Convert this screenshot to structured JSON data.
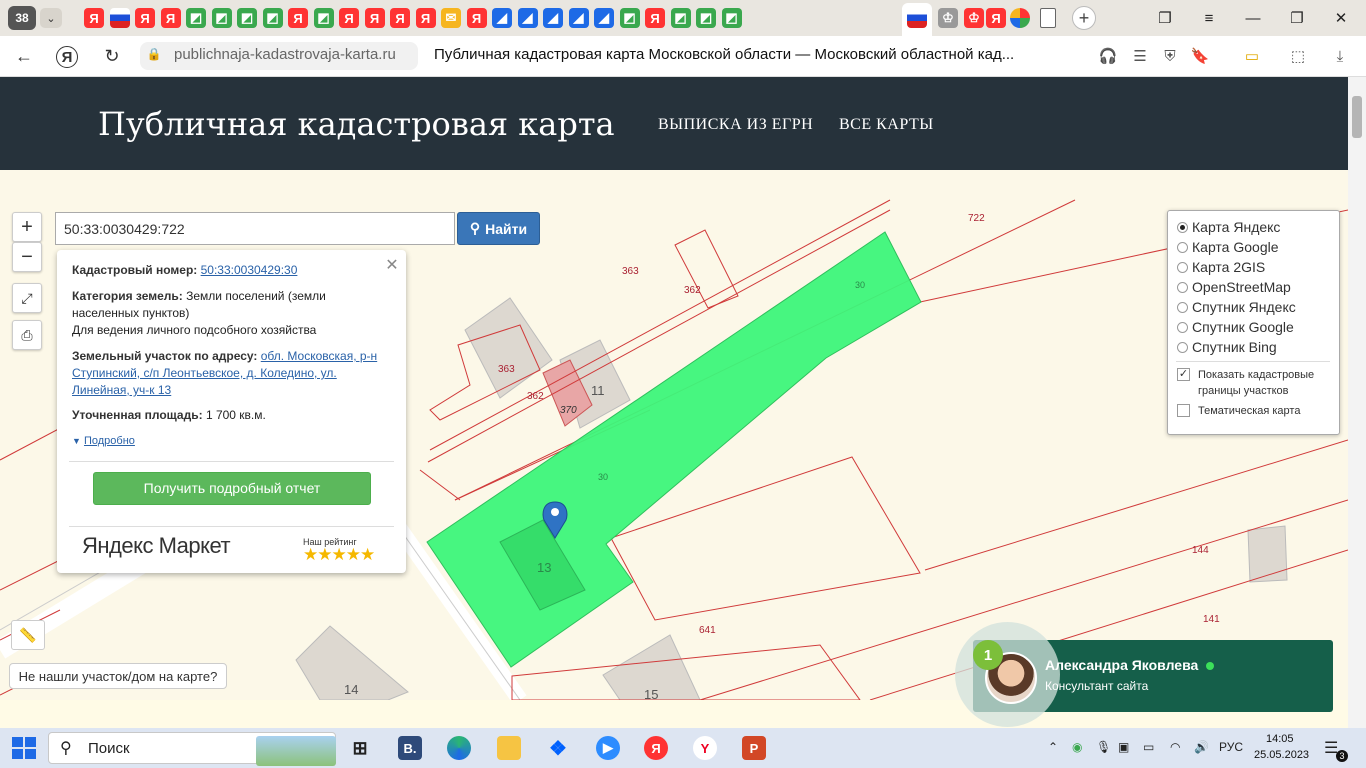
{
  "browser": {
    "tab_count": "38",
    "url": "publichnaja-kadastrovaja-karta.ru",
    "page_title": "Публичная кадастровая карта Московской области — Московский областной кад..."
  },
  "site": {
    "title": "Публичная кадастровая карта",
    "nav": [
      "ВЫПИСКА ИЗ ЕГРН",
      "ВСЕ КАРТЫ"
    ]
  },
  "search": {
    "value": "50:33:0030429:722",
    "button_label": "Найти"
  },
  "map_controls": {
    "zoom_in": "+",
    "zoom_out": "−"
  },
  "popup": {
    "cadastral_label": "Кадастровый номер:",
    "cadastral_number": "50:33:0030429:30",
    "category_label": "Категория земель:",
    "category_value": "Земли поселений (земли населенных пунктов)",
    "usage": "Для ведения личного подсобного хозяйства",
    "address_label": "Земельный участок по адресу:",
    "address_value": "обл. Московская, р-н Ступинский, с/п Леонтьевское, д. Коледино, ул. Линейная, уч-к 13",
    "area_label": "Уточненная площадь:",
    "area_value": "1 700 кв.м.",
    "details_link": "Подробно",
    "report_button": "Получить подробный отчет",
    "market_logo": "Яндекс Маркет",
    "rating_label": "Наш рейтинг",
    "rating_stars": "★★★★★"
  },
  "layers": {
    "options": [
      "Карта Яндекс",
      "Карта Google",
      "Карта 2GIS",
      "OpenStreetMap",
      "Спутник Яндекс",
      "Спутник Google",
      "Спутник Bing"
    ],
    "selected": "Карта Яндекс",
    "show_boundaries": "Показать кадастровые границы участков",
    "thematic_map": "Тематическая карта"
  },
  "map_labels": {
    "l722": "722",
    "l363a": "363",
    "l362a": "362",
    "l30a": "30",
    "l363b": "363",
    "l362b": "362",
    "l370": "370",
    "l11": "11",
    "l30b": "30",
    "l13": "13",
    "l144": "144",
    "l641": "641",
    "l141": "141",
    "l14": "14",
    "l15": "15"
  },
  "not_found": "Не нашли участок/дом на карте?",
  "consultant": {
    "badge": "1",
    "name": "Александра Яковлева",
    "role": "Консультант сайта"
  },
  "taskbar": {
    "search_placeholder": "Поиск",
    "language": "РУС",
    "time": "14:05",
    "date": "25.05.2023",
    "notifications": "3"
  },
  "colors": {
    "header_bg": "#26323b",
    "parcel_fill": "#3df57a",
    "boundary": "#d03a3a",
    "button_blue": "#3a76b8",
    "button_green": "#5cb85c",
    "consultant_bg": "#155f4a"
  }
}
